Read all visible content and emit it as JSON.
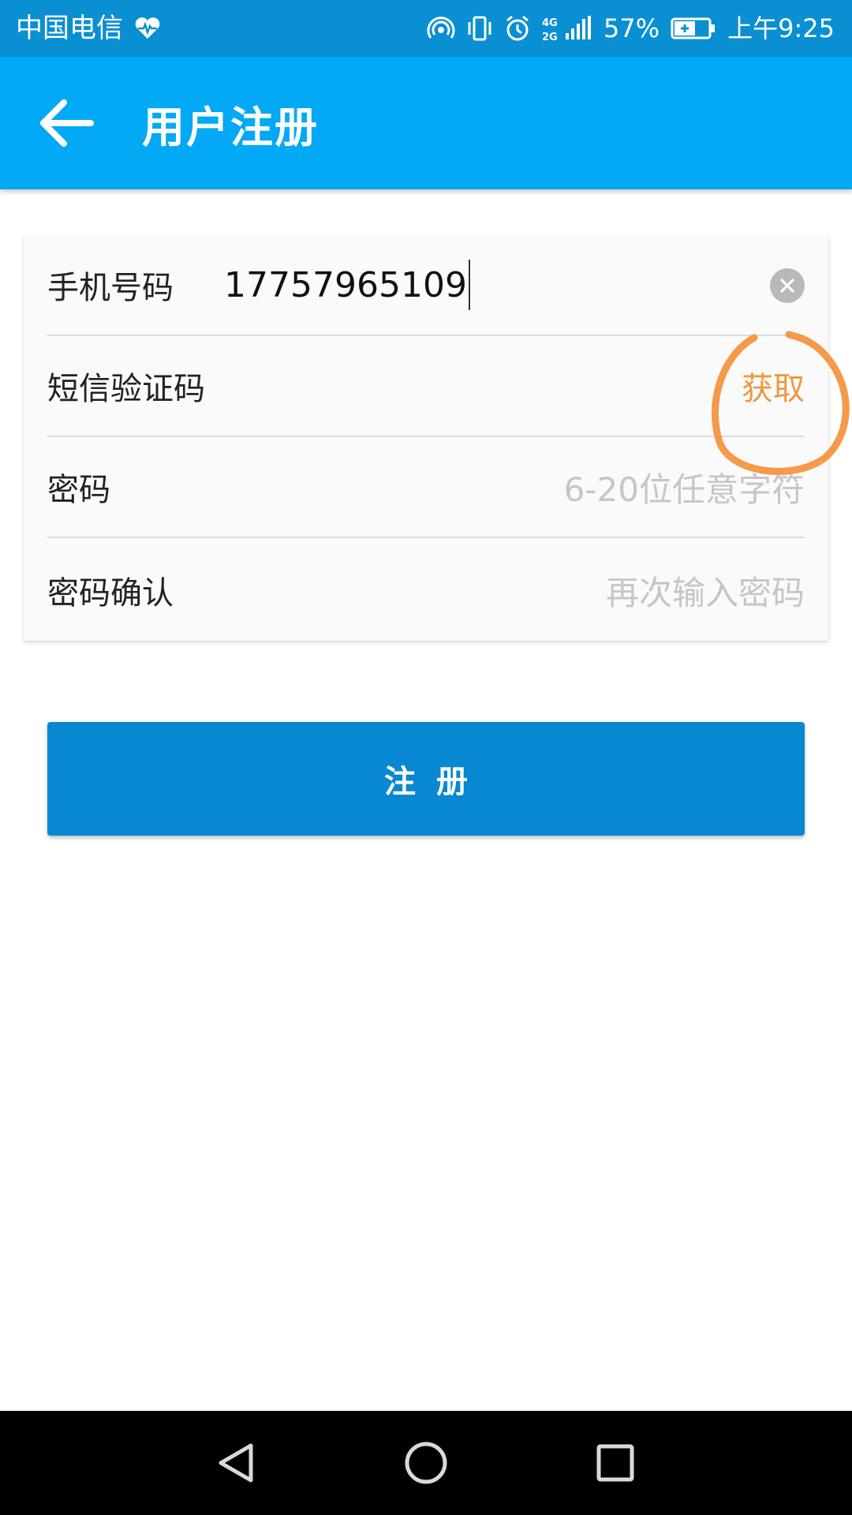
{
  "status_bar": {
    "carrier": "中国电信",
    "battery": "57%",
    "time": "上午9:25",
    "network": "4G",
    "network2": "2G",
    "icons": [
      "heart-pulse-icon",
      "hotspot-icon",
      "vibrate-icon",
      "alarm-icon",
      "signal-icon",
      "battery-charging-icon"
    ]
  },
  "app_bar": {
    "title": "用户注册",
    "back_icon": "arrow-left-icon"
  },
  "form": {
    "phone": {
      "label": "手机号码",
      "value": "17757965109",
      "clear_icon": "clear-circle-icon"
    },
    "sms_code": {
      "label": "短信验证码",
      "action_label": "获取"
    },
    "password": {
      "label": "密码",
      "placeholder": "6-20位任意字符"
    },
    "password_confirm": {
      "label": "密码确认",
      "placeholder": "再次输入密码"
    }
  },
  "register_button": {
    "label": "注册"
  },
  "colors": {
    "status_bar": "#0a8fd2",
    "app_bar": "#03a9f4",
    "primary_button": "#0788d0",
    "accent": "#f0983e",
    "annotation": "#f49a4a"
  },
  "nav_bar": {
    "icons": [
      "back-triangle-icon",
      "home-circle-icon",
      "recents-square-icon"
    ]
  }
}
